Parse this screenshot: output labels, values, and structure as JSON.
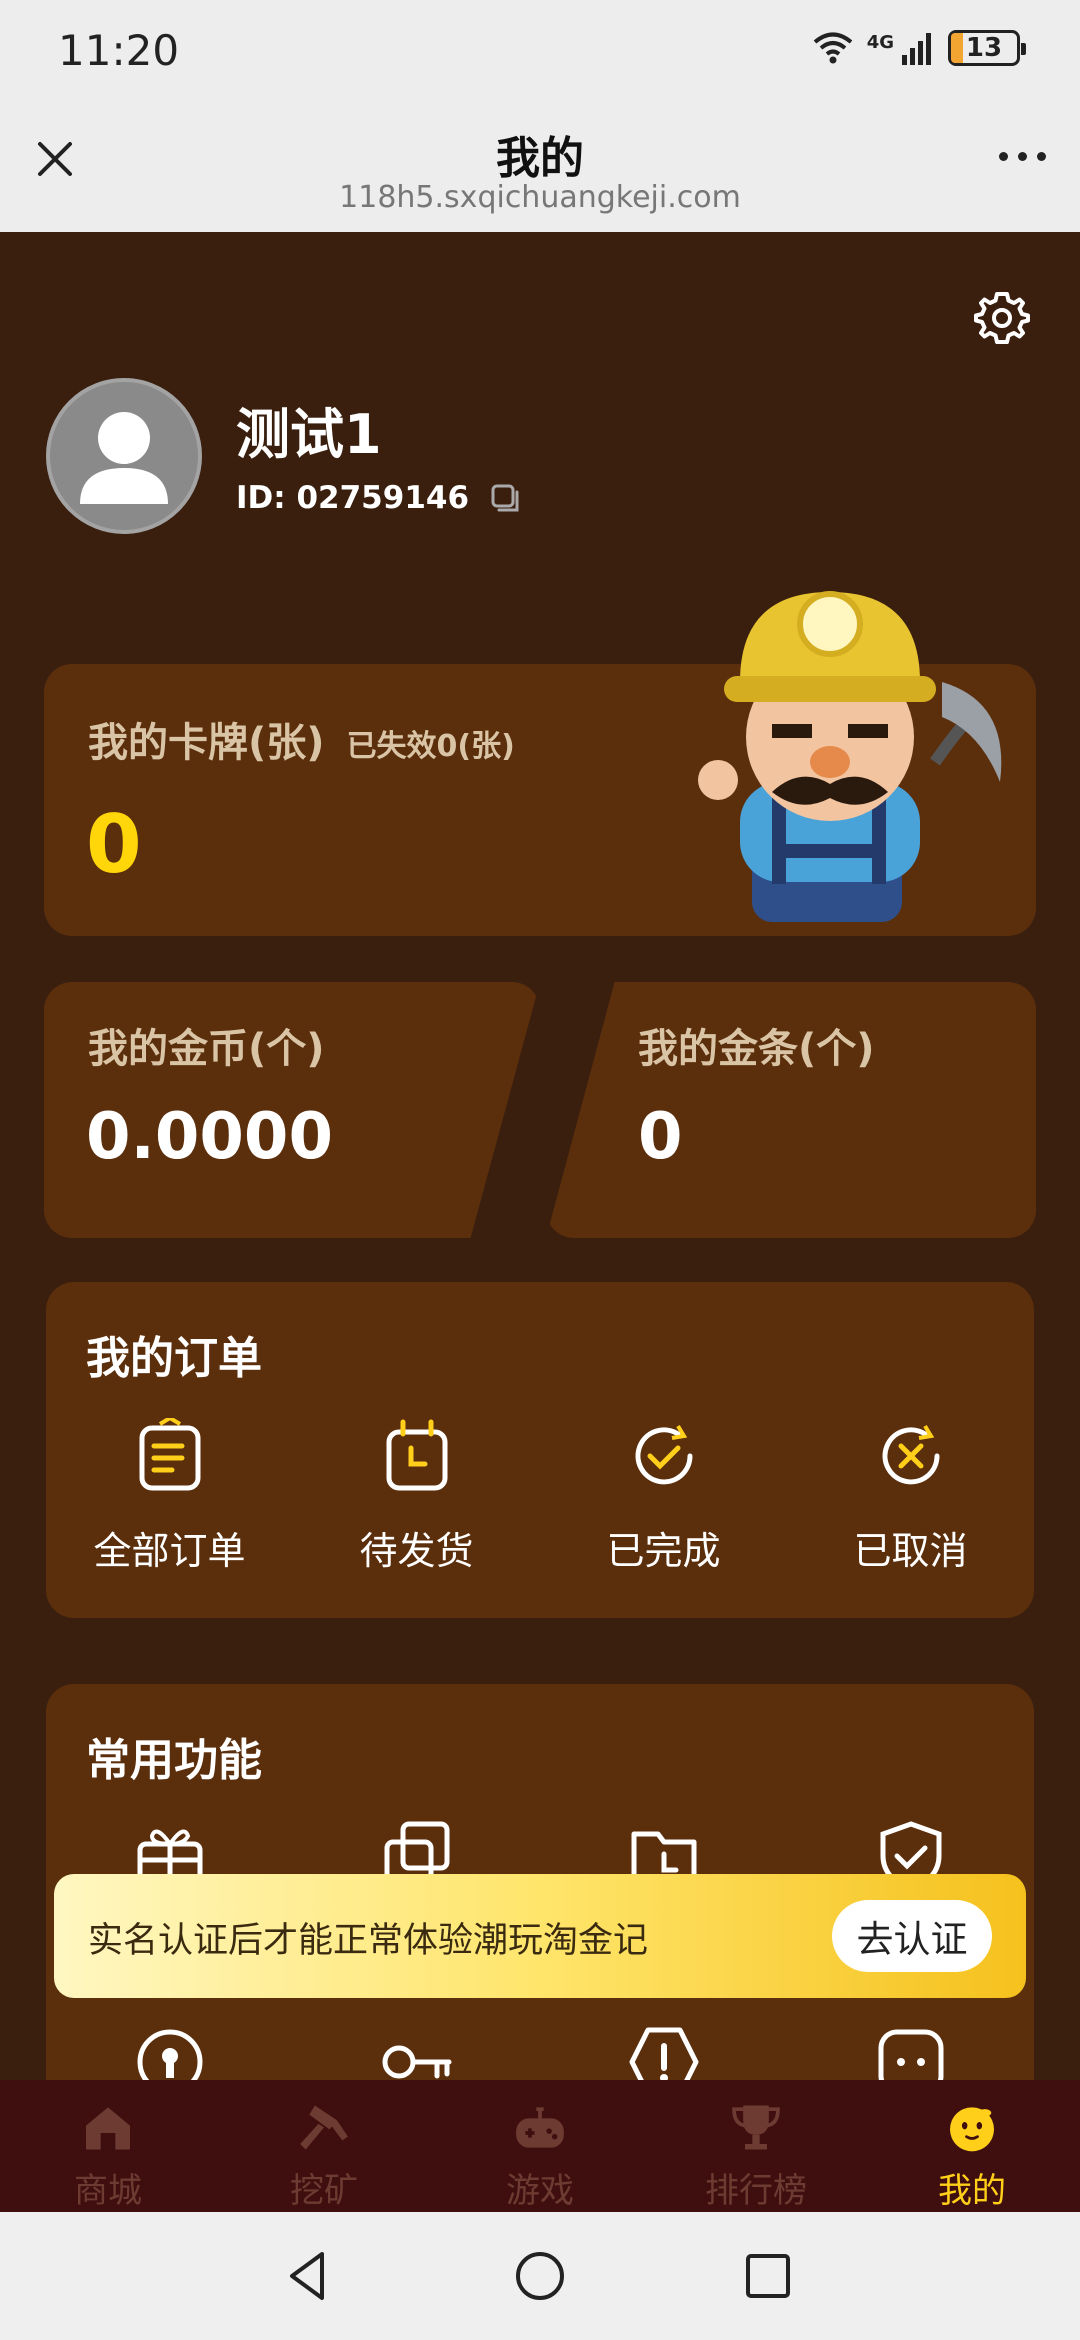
{
  "status_bar": {
    "time": "11:20",
    "network": "4G",
    "battery": "13"
  },
  "title_bar": {
    "title": "我的",
    "url": "118h5.sxqichuangkeji.com"
  },
  "profile": {
    "username": "测试1",
    "id_label": "ID:",
    "id_value": "02759146"
  },
  "cards_summary": {
    "label": "我的卡牌(张)",
    "sublabel": "已失效0(张)",
    "value": "0",
    "value_color": "#ffd60a"
  },
  "gold_coins": {
    "label": "我的金币(个)",
    "value": "0.0000"
  },
  "gold_bars": {
    "label": "我的金条(个)",
    "value": "0"
  },
  "orders": {
    "title": "我的订单",
    "items": [
      {
        "label": "全部订单",
        "icon": "order-list-icon"
      },
      {
        "label": "待发货",
        "icon": "pending-shipment-icon"
      },
      {
        "label": "已完成",
        "icon": "completed-icon"
      },
      {
        "label": "已取消",
        "icon": "cancelled-icon"
      }
    ]
  },
  "common_functions": {
    "title": "常用功能",
    "row1_icons": [
      "gift-icon",
      "copy-boxes-icon",
      "folder-clock-icon",
      "shield-check-icon"
    ],
    "row2_icons": [
      "lock-icon",
      "key-icon",
      "warning-icon",
      "chat-icon"
    ]
  },
  "verify_banner": {
    "text": "实名认证后才能正常体验潮玩淘金记",
    "button": "去认证"
  },
  "tab_bar": {
    "items": [
      {
        "label": "商城",
        "icon": "shop-icon",
        "active": false
      },
      {
        "label": "挖矿",
        "icon": "hammer-icon",
        "active": false
      },
      {
        "label": "游戏",
        "icon": "gamepad-icon",
        "active": false
      },
      {
        "label": "排行榜",
        "icon": "trophy-icon",
        "active": false
      },
      {
        "label": "我的",
        "icon": "smile-face-icon",
        "active": true
      }
    ],
    "active_color": "#ffcf1a",
    "inactive_color": "#6e3b32"
  },
  "colors": {
    "background": "#3a1f0f",
    "card": "#5b2e0c",
    "accent": "#ffd60a"
  }
}
